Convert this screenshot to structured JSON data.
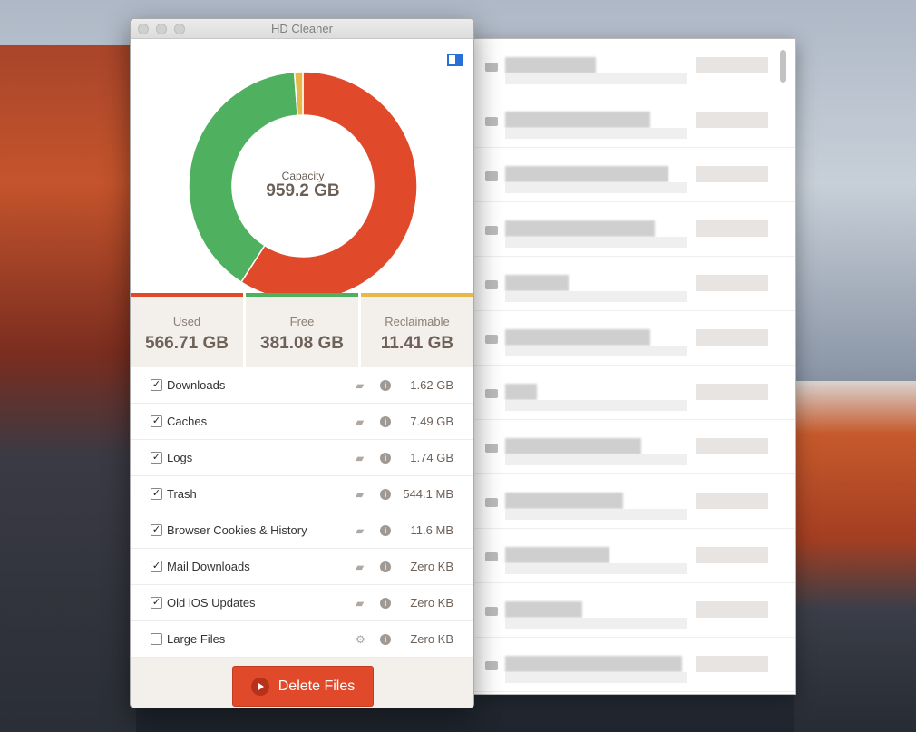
{
  "window": {
    "title": "HD Cleaner"
  },
  "disk": {
    "capacity_label": "Capacity",
    "capacity": "959.2 GB",
    "used_gb": 566.71,
    "free_gb": 381.08,
    "reclaimable_gb": 11.41
  },
  "colors": {
    "used": "#e04a2a",
    "free": "#4fb060",
    "reclaimable": "#e6b84a"
  },
  "stats": [
    {
      "label": "Used",
      "value": "566.71 GB"
    },
    {
      "label": "Free",
      "value": "381.08 GB"
    },
    {
      "label": "Reclaimable",
      "value": "11.41 GB"
    }
  ],
  "items": [
    {
      "label": "Downloads",
      "checked": true,
      "action_icon": "folder-icon",
      "size": "1.62 GB"
    },
    {
      "label": "Caches",
      "checked": true,
      "action_icon": "folder-icon",
      "size": "7.49 GB"
    },
    {
      "label": "Logs",
      "checked": true,
      "action_icon": "folder-icon",
      "size": "1.74 GB"
    },
    {
      "label": "Trash",
      "checked": true,
      "action_icon": "folder-icon",
      "size": "544.1 MB"
    },
    {
      "label": "Browser Cookies & History",
      "checked": true,
      "action_icon": "folder-icon",
      "size": "11.6 MB"
    },
    {
      "label": "Mail Downloads",
      "checked": true,
      "action_icon": "folder-icon",
      "size": "Zero KB"
    },
    {
      "label": "Old iOS Updates",
      "checked": true,
      "action_icon": "folder-icon",
      "size": "Zero KB"
    },
    {
      "label": "Large Files",
      "checked": false,
      "action_icon": "gear-icon",
      "size": "Zero KB"
    }
  ],
  "footer": {
    "delete_label": "Delete Files"
  }
}
